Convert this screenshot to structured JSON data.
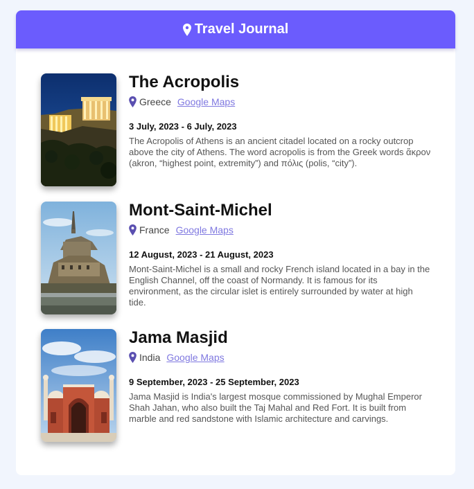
{
  "app": {
    "title": "Travel Journal",
    "accent_color": "#6b5cfd",
    "header_icon": "map-pin-icon"
  },
  "entries": [
    {
      "title": "The Acropolis",
      "country": "Greece",
      "maps_link": "Google Maps",
      "dates": "3 July, 2023 - 6 July, 2023",
      "description": "The Acropolis of Athens is an ancient citadel located on a rocky outcrop above the city of Athens. The word acropolis is from the Greek words ἄκρον (akron, “highest point, extremity”) and πόλις (polis, “city”).",
      "image_icon": "acropolis-photo"
    },
    {
      "title": "Mont-Saint-Michel",
      "country": "France",
      "maps_link": "Google Maps",
      "dates": "12 August, 2023 - 21 August, 2023",
      "description": "Mont-Saint-Michel is a small and rocky French island located in a bay in the English Channel, off the coast of Normandy. It is famous for its environment, as the circular islet is entirely surrounded by water at high tide.",
      "image_icon": "mont-saint-michel-photo"
    },
    {
      "title": "Jama Masjid",
      "country": "India",
      "maps_link": "Google Maps",
      "dates": "9 September, 2023 - 25 September, 2023",
      "description": "Jama Masjid is India's largest mosque commissioned by Mughal Emperor Shah Jahan, who also built the Taj Mahal and Red Fort. It is built from marble and red sandstone with Islamic architecture and carvings.",
      "image_icon": "jama-masjid-photo"
    }
  ]
}
